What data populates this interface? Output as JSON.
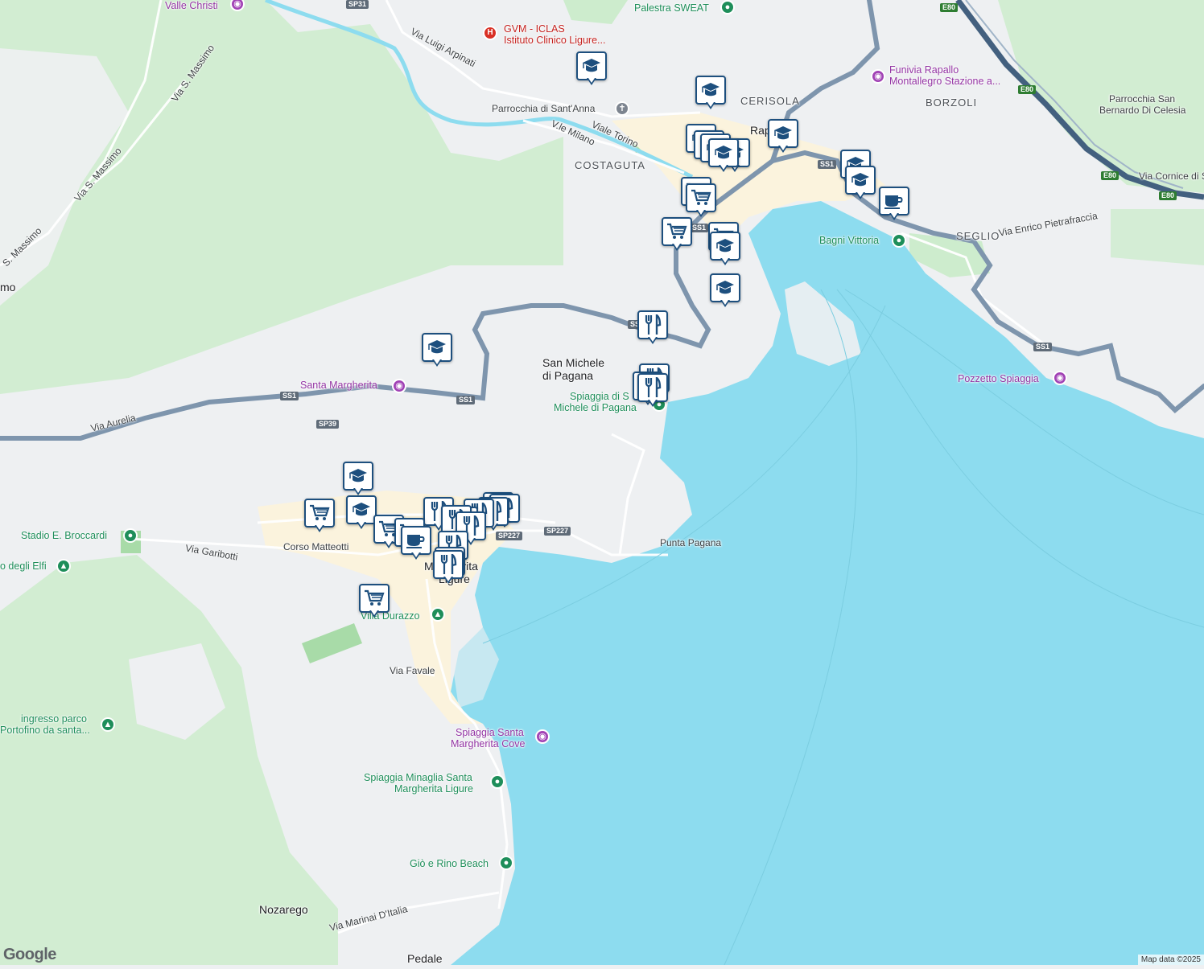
{
  "map": {
    "colors": {
      "land": "#eef0f2",
      "water": "#8ddcef",
      "park": "#c8ebc8",
      "road": "#ffffff",
      "highway": "#7e95ad",
      "urban": "#fbf3dd",
      "pin_border": "#1d4f7e"
    },
    "labels": {
      "valle_christi": "Valle Christi",
      "gvm_line1": "GVM - ICLAS",
      "gvm_line2": "Istituto Clinico Ligure...",
      "palestra": "Palestra SWEAT",
      "via_luigi": "Via Luigi Arpinati",
      "funivia_line1": "Funivia Rapallo",
      "funivia_line2": "Montallegro Stazione a...",
      "parrocchia_anna": "Parrocchia di Sant'Anna",
      "viale_torino": "Viale Torino",
      "vle_milano": "V.le Milano",
      "cerisola": "CERISOLA",
      "borzoli": "BORZOLI",
      "parrocchia_line1": "Parrocchia San",
      "parrocchia_line2": "Bernardo Di Celesia",
      "costaguta": "COSTAGUTA",
      "rapallo": "Rapallo",
      "via_cornice": "Via Cornice di Sa",
      "bagni_vittoria": "Bagni Vittoria",
      "seglio": "SEGLIO",
      "via_enrico": "Via Enrico Pietrafraccia",
      "via_s_massimo_1": "Via S. Massimo",
      "via_s_massimo_2": "Via S. Massimo",
      "via_s_massimo_3": "S. Massimo",
      "mo": "mo",
      "san_michele_line1": "San Michele",
      "san_michele_line2": "di Pagana",
      "pozzetto": "Pozzetto Spiaggia",
      "santa_margherita": "Santa Margherita",
      "spiaggia_sm_line1": "Spiaggia di S",
      "spiaggia_sm_line2": "Michele di Pagana",
      "via_aurelia": "Via Aurelia",
      "stadio": "Stadio E. Broccardi",
      "via_garibotti": "Via Garibotti",
      "corso_matteotti": "Corso Matteotti",
      "punta_pagana": "Punta Pagana",
      "degli_elfi": "o degli Elfi",
      "margherita_line1": "Margherita",
      "margherita_line2": "Ligure",
      "villa_durazzo": "Villa Durazzo",
      "via_favale": "Via Favale",
      "ingresso_line1": "ingresso parco",
      "ingresso_line2": "Portofino da santa...",
      "spiaggia_cove_line1": "Spiaggia Santa",
      "spiaggia_cove_line2": "Margherita Cove",
      "minaglia_line1": "Spiaggia Minaglia Santa",
      "minaglia_line2": "Margherita Ligure",
      "gio_rino": "Giò e Rino Beach",
      "nozarego": "Nozarego",
      "via_marinai": "Via Marinai D'Italia",
      "pedale": "Pedale"
    },
    "shields": {
      "sp31": "SP31",
      "e80_a": "E80",
      "e80_b": "E80",
      "e80_c": "E80",
      "e80_d": "E80",
      "ss1_a": "SS1",
      "ss1_b": "SS1",
      "ss1_c": "SS1",
      "ss1_d": "SS1",
      "ss1_e": "SS1",
      "ss1_f": "SS1",
      "sp39": "SP39",
      "sp227_a": "SP227",
      "sp227_b": "SP227"
    },
    "google_logo": "Google",
    "attribution": "Map data ©2025"
  }
}
